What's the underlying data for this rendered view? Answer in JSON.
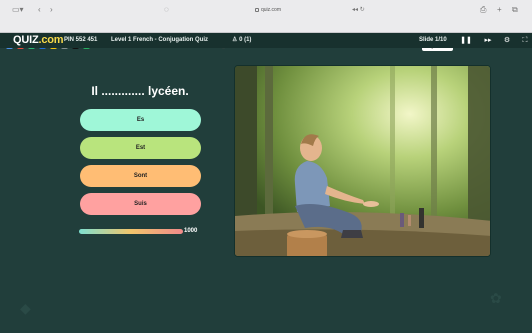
{
  "browser": {
    "address": "quiz.com",
    "tabs": [
      "La langue en matière lumineuse",
      "Quiz.com"
    ],
    "favicon_colors": [
      "#4a8fe8",
      "#e74c3c",
      "#2bb673",
      "#1d6fd8",
      "#f1c40f",
      "#7f8c8d",
      "#111111",
      "#27ae60"
    ]
  },
  "topbar": {
    "logo": "QUIZ",
    "logo_suffix": ".com",
    "pin": "PIN 552 451",
    "quiz_title": "Level 1 French - Conjugation Quiz",
    "players": "0 (1)",
    "slide": "Slide 1/10",
    "icons": [
      "pause-icon",
      "skip-icon",
      "settings-icon",
      "fullscreen-icon"
    ]
  },
  "question": {
    "sentence": "Il ............. lycéen."
  },
  "answers": [
    {
      "label": "Es",
      "color": "#9ff7d8"
    },
    {
      "label": "Est",
      "color": "#b9e47d"
    },
    {
      "label": "Sont",
      "color": "#ffbd74"
    },
    {
      "label": "Suis",
      "color": "#ffa1a0"
    }
  ],
  "timer": {
    "points": "1000",
    "remaining_fraction": 1.0
  },
  "colors": {
    "background": "#213e3b",
    "topbar": "#18312e"
  }
}
